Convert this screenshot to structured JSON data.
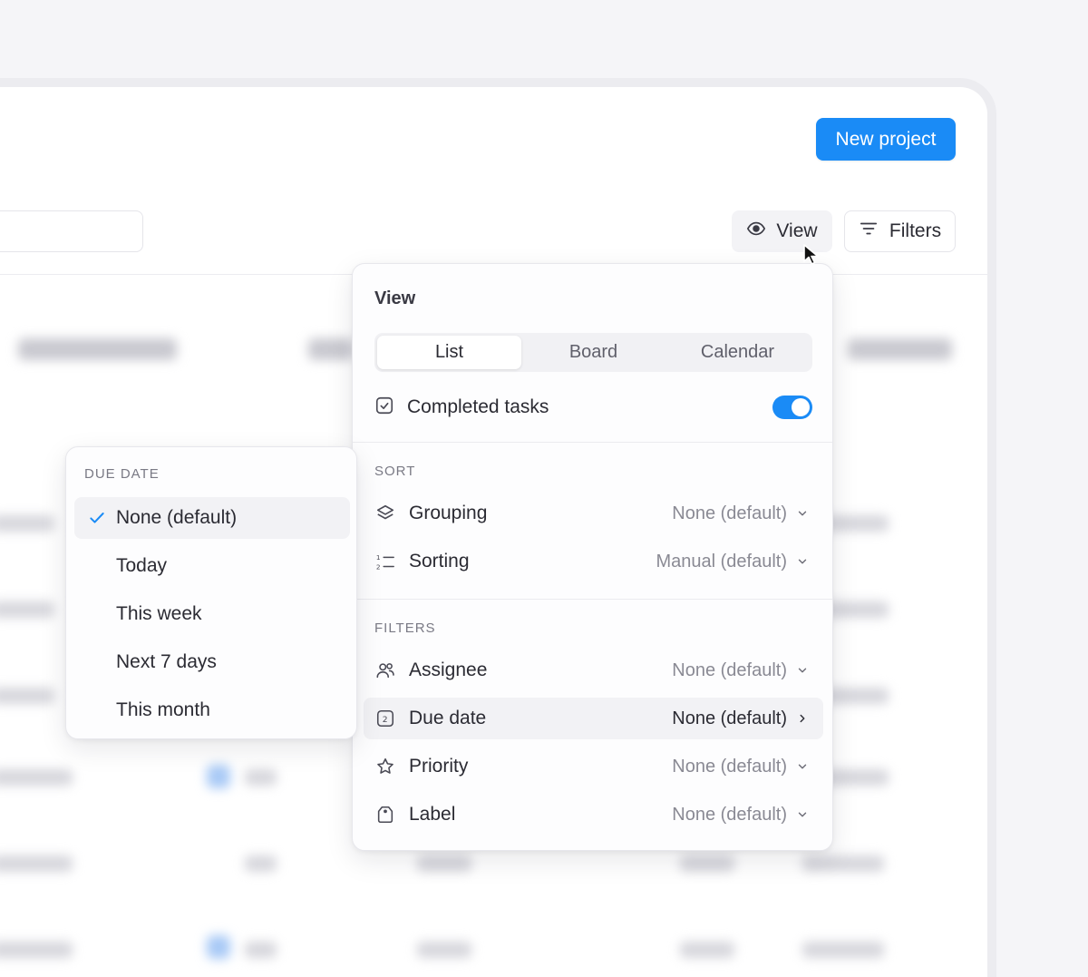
{
  "header": {
    "new_project_label": "New project",
    "view_label": "View",
    "filters_label": "Filters"
  },
  "view_panel": {
    "title": "View",
    "layout_tabs": [
      {
        "label": "List",
        "active": true
      },
      {
        "label": "Board",
        "active": false
      },
      {
        "label": "Calendar",
        "active": false
      }
    ],
    "completed_tasks": {
      "label": "Completed tasks",
      "enabled": true
    },
    "sort": {
      "label": "SORT",
      "rows": [
        {
          "label": "Grouping",
          "value": "None (default)",
          "icon": "layers-icon"
        },
        {
          "label": "Sorting",
          "value": "Manual (default)",
          "icon": "sort-list-icon"
        }
      ]
    },
    "filters": {
      "label": "FILTERS",
      "rows": [
        {
          "label": "Assignee",
          "value": "None (default)",
          "icon": "users-icon"
        },
        {
          "label": "Due date",
          "value": "None (default)",
          "icon": "calendar-icon"
        },
        {
          "label": "Priority",
          "value": "None (default)",
          "icon": "star-icon"
        },
        {
          "label": "Label",
          "value": "None (default)",
          "icon": "tag-icon"
        }
      ]
    }
  },
  "due_date_menu": {
    "title": "DUE DATE",
    "options": [
      {
        "label": "None (default)",
        "selected": true
      },
      {
        "label": "Today",
        "selected": false
      },
      {
        "label": "This week",
        "selected": false
      },
      {
        "label": "Next 7 days",
        "selected": false
      },
      {
        "label": "This month",
        "selected": false
      }
    ]
  },
  "colors": {
    "accent": "#1a8bf6",
    "background": "#f5f5f8",
    "panel": "#fdfdfe"
  }
}
